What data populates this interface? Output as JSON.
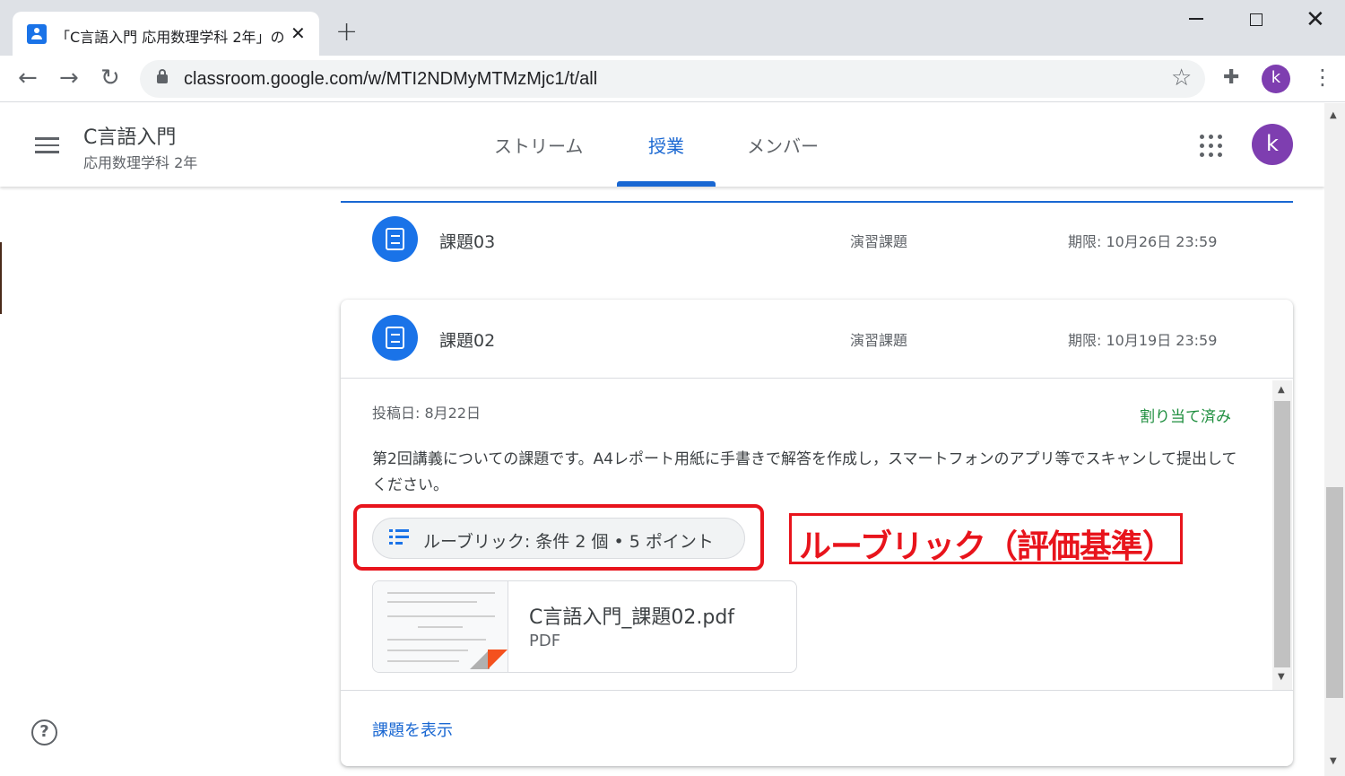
{
  "browser": {
    "tab_title": "「C言語入門 応用数理学科 2年」の",
    "tab_close": "✕",
    "new_tab": "+",
    "url": "classroom.google.com/w/MTI2NDMyMTMzMjc1/t/all",
    "profile_initial": "k"
  },
  "header": {
    "class_name": "C言語入門",
    "class_section": "応用数理学科 2年",
    "tabs": [
      {
        "label": "ストリーム"
      },
      {
        "label": "授業"
      },
      {
        "label": "メンバー"
      }
    ],
    "active_tab": "授業",
    "avatar_initial": "k"
  },
  "assignments": [
    {
      "title": "課題03",
      "type": "演習課題",
      "due": "期限: 10月26日 23:59"
    },
    {
      "title": "課題02",
      "type": "演習課題",
      "due": "期限: 10月19日 23:59",
      "posted": "投稿日: 8月22日",
      "status": "割り当て済み",
      "description": "第2回講義についての課題です。A4レポート用紙に手書きで解答を作成し，スマートフォンのアプリ等でスキャンして提出してください。",
      "rubric": "ルーブリック: 条件 2 個 • 5 ポイント",
      "attachment": {
        "name": "C言語入門_課題02.pdf",
        "type": "PDF"
      },
      "view_link": "課題を表示"
    }
  ],
  "annotation": "ルーブリック（評価基準）",
  "help": "?",
  "colors": {
    "accent": "#1967d2",
    "avatar": "#7e3eb0",
    "status_green": "#1e8e3e",
    "annotation_red": "#e8141c"
  }
}
